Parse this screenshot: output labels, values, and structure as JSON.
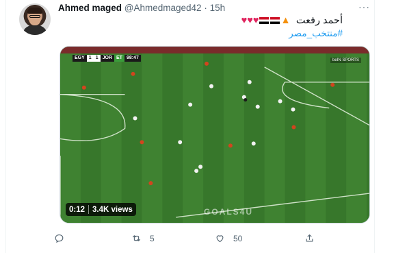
{
  "tweet": {
    "author_name": "Ahmed maged",
    "author_handle": "@Ahmedmaged42",
    "separator": "·",
    "time": "15h",
    "more_label": "···",
    "text": "أحمد رفعت",
    "hashtag": "#منتخب_مصر"
  },
  "media": {
    "scorebug": {
      "home": "EGY",
      "home_score": "1",
      "away_score": "1",
      "away": "JOR",
      "period": "ET",
      "clock": "98:47"
    },
    "channel": "beIN SPORTS",
    "watermark": "GOALS4U",
    "duration": "0:12",
    "views": "3.4K views"
  },
  "actions": {
    "reply_icon": "reply-icon",
    "retweet_icon": "retweet-icon",
    "retweet_count": "5",
    "like_icon": "heart-outline-icon",
    "like_count": "50",
    "share_icon": "share-icon"
  },
  "colors": {
    "accent": "#1d9bf0",
    "pitch": "#3b7a2e",
    "muted": "#536471"
  }
}
